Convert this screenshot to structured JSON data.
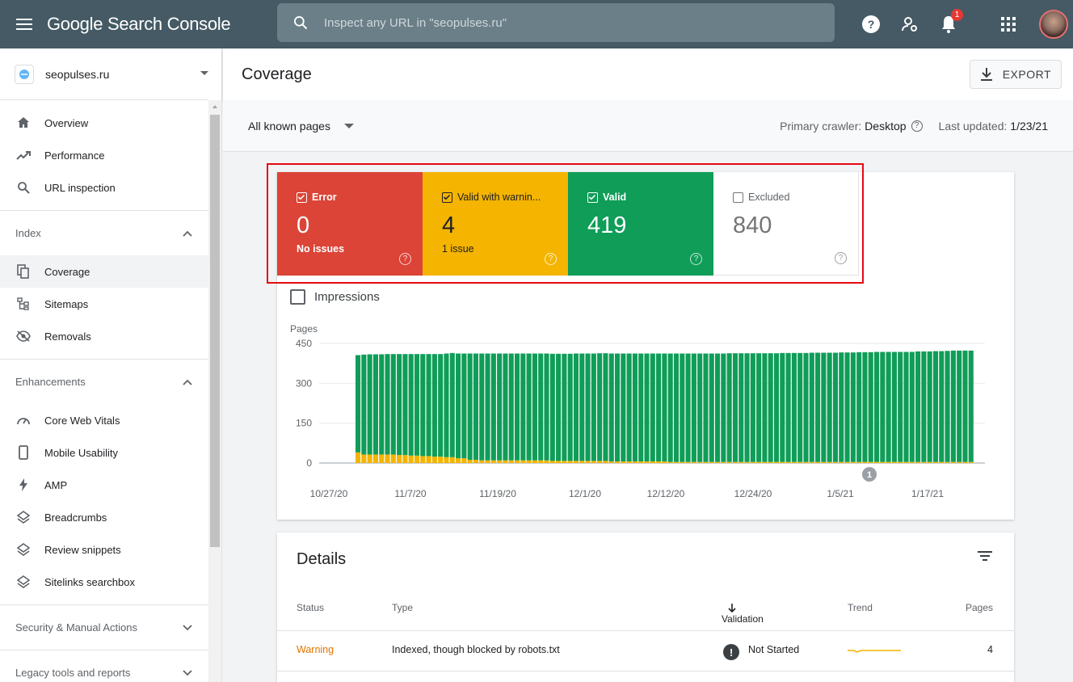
{
  "app": {
    "title": "Google Search Console",
    "search_placeholder": "Inspect any URL in \"seopulses.ru\"",
    "notification_count": "1"
  },
  "sidebar": {
    "property": "seopulses.ru",
    "top_items": [
      {
        "label": "Overview",
        "icon": "home-icon"
      },
      {
        "label": "Performance",
        "icon": "trending-up-icon"
      },
      {
        "label": "URL inspection",
        "icon": "search-icon"
      }
    ],
    "index": {
      "title": "Index",
      "items": [
        {
          "label": "Coverage",
          "icon": "coverage-icon",
          "active": true
        },
        {
          "label": "Sitemaps",
          "icon": "sitemap-icon"
        },
        {
          "label": "Removals",
          "icon": "visibility-off-icon"
        }
      ]
    },
    "enhancements": {
      "title": "Enhancements",
      "items": [
        {
          "label": "Core Web Vitals",
          "icon": "speed-icon"
        },
        {
          "label": "Mobile Usability",
          "icon": "smartphone-icon"
        },
        {
          "label": "AMP",
          "icon": "bolt-icon"
        },
        {
          "label": "Breadcrumbs",
          "icon": "layers-icon"
        },
        {
          "label": "Review snippets",
          "icon": "layers-icon"
        },
        {
          "label": "Sitelinks searchbox",
          "icon": "layers-icon"
        }
      ]
    },
    "security_title": "Security & Manual Actions",
    "legacy_title": "Legacy tools and reports"
  },
  "header": {
    "title": "Coverage",
    "export_label": "EXPORT"
  },
  "filter": {
    "pages_select": "All known pages",
    "crawler_label": "Primary crawler:",
    "crawler_value": "Desktop",
    "updated_label": "Last updated:",
    "updated_value": "1/23/21"
  },
  "tiles": [
    {
      "label": "Error",
      "value": "0",
      "sub": "No issues",
      "checked": true,
      "color": "#db4437"
    },
    {
      "label": "Valid with warnin...",
      "value": "4",
      "sub": "1 issue",
      "checked": true,
      "color": "#f4b400"
    },
    {
      "label": "Valid",
      "value": "419",
      "sub": "",
      "checked": true,
      "color": "#0f9d58"
    },
    {
      "label": "Excluded",
      "value": "840",
      "sub": "",
      "checked": false,
      "color": "#ffffff"
    }
  ],
  "impressions_label": "Impressions",
  "chart_data": {
    "type": "bar",
    "stacked": true,
    "ylabel": "Pages",
    "ylim": [
      0,
      450
    ],
    "yticks": [
      0,
      150,
      300,
      450
    ],
    "xticks": [
      "10/27/20",
      "11/7/20",
      "11/19/20",
      "12/1/20",
      "12/12/20",
      "12/24/20",
      "1/5/21",
      "1/17/21"
    ],
    "annotation": "1",
    "series": [
      {
        "name": "Valid",
        "color": "#0f9d58",
        "values": [
          366,
          376,
          377,
          377,
          377,
          378,
          378,
          380,
          380,
          382,
          382,
          384,
          384,
          386,
          386,
          390,
          392,
          394,
          394,
          400,
          400,
          402,
          402,
          402,
          402,
          402,
          402,
          402,
          402,
          402,
          402,
          402,
          402,
          403,
          403,
          403,
          403,
          404,
          404,
          404,
          404,
          405,
          405,
          406,
          406,
          406,
          406,
          406,
          406,
          406,
          406,
          406,
          406,
          408,
          408,
          408,
          408,
          408,
          408,
          408,
          408,
          408,
          408,
          409,
          409,
          409,
          409,
          409,
          409,
          409,
          409,
          409,
          410,
          410,
          410,
          410,
          410,
          411,
          411,
          411,
          411,
          411,
          412,
          412,
          412,
          413,
          413,
          413,
          414,
          414,
          414,
          414,
          414,
          414,
          414,
          416,
          416,
          416,
          417,
          417,
          418,
          419,
          419,
          419,
          419
        ]
      },
      {
        "name": "Valid with warnings",
        "color": "#f4b400",
        "values": [
          40,
          32,
          32,
          32,
          32,
          32,
          32,
          30,
          30,
          28,
          28,
          26,
          26,
          24,
          24,
          22,
          22,
          18,
          18,
          12,
          12,
          10,
          10,
          10,
          10,
          10,
          10,
          10,
          10,
          10,
          10,
          10,
          10,
          8,
          8,
          8,
          8,
          8,
          8,
          8,
          8,
          8,
          8,
          6,
          6,
          6,
          6,
          6,
          6,
          6,
          6,
          6,
          6,
          4,
          4,
          4,
          4,
          4,
          4,
          4,
          4,
          4,
          4,
          4,
          4,
          4,
          4,
          4,
          4,
          4,
          4,
          4,
          4,
          4,
          4,
          4,
          4,
          4,
          4,
          4,
          4,
          4,
          4,
          4,
          4,
          4,
          4,
          4,
          4,
          4,
          4,
          4,
          4,
          4,
          4,
          4,
          4,
          4,
          4,
          4,
          4,
          4,
          4,
          4,
          4
        ]
      }
    ]
  },
  "details": {
    "title": "Details",
    "columns": {
      "status": "Status",
      "type": "Type",
      "validation": "Validation",
      "trend": "Trend",
      "pages": "Pages"
    },
    "rows": [
      {
        "status": "Warning",
        "type": "Indexed, though blocked by robots.txt",
        "validation": "Not Started",
        "pages": "4"
      }
    ]
  }
}
